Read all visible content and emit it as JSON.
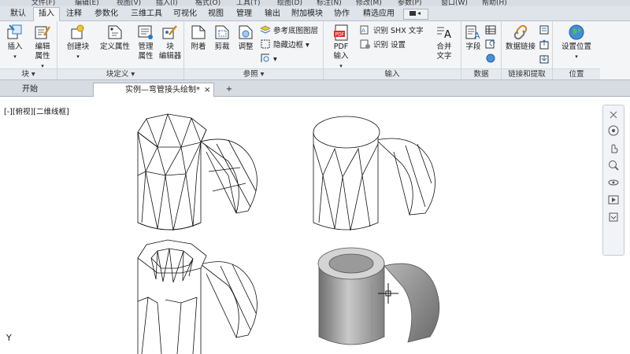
{
  "menubar": {
    "items": [
      "文件(F)",
      "编辑(E)",
      "视图(V)",
      "插入(I)",
      "格式(O)",
      "工具(T)",
      "绘图(D)",
      "标注(N)",
      "修改(M)",
      "参数(P)",
      "窗口(W)",
      "帮助(H)"
    ]
  },
  "ribbon_tabs": {
    "items": [
      "默认",
      "插入",
      "注释",
      "参数化",
      "三维工具",
      "可视化",
      "视图",
      "管理",
      "输出",
      "附加模块",
      "协作",
      "精选应用"
    ],
    "active": "插入"
  },
  "panels": {
    "block": {
      "title": "块",
      "insert": "插入",
      "edit_attr_1": "编辑",
      "edit_attr_2": "属性"
    },
    "block_def": {
      "title": "块定义",
      "create_block": "创建块",
      "define_attr": "定义属性",
      "manage_attr_1": "管理",
      "manage_attr_2": "属性",
      "block_editor_1": "块",
      "block_editor_2": "编辑器"
    },
    "reference": {
      "title": "参照",
      "attach": "附着",
      "clip": "剪裁",
      "adjust": "调整",
      "underlay_layers": "参考底图图层",
      "hide_frames": "隐藏边框"
    },
    "import": {
      "title": "输入",
      "pdf_1": "PDF",
      "pdf_2": "输入",
      "recognize_shx": "识别 SHX 文字",
      "recognize_settings": "识别 设置",
      "combine_text_1": "合并",
      "combine_text_2": "文字"
    },
    "data": {
      "title": "数据",
      "field": "字段"
    },
    "link_extract": {
      "title": "链接和提取",
      "data_link": "数据链接"
    },
    "location": {
      "title": "位置",
      "set_location": "设置位置"
    }
  },
  "doc_tabs": {
    "start": "开始",
    "active": "实例—弯管接头绘制*",
    "close": "×",
    "new_tab": "+"
  },
  "canvas": {
    "view_label": "[-][俯视][二维线框]",
    "ucs_y": "Y"
  },
  "colors": {
    "accent": "#2b79c2",
    "ribbon_bg": "#f3f5f7",
    "tab_bg": "#dfe4ea",
    "canvas_bg": "#ffffff",
    "wire": "#111111",
    "shade": "#8c8c8c"
  }
}
